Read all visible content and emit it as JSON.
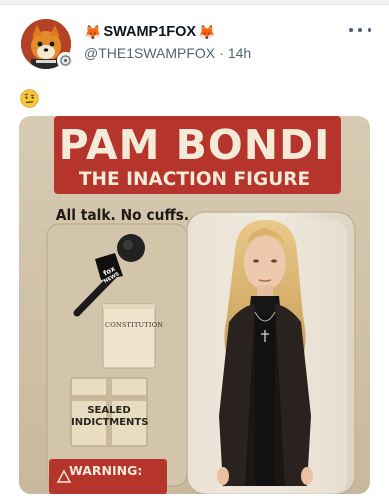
{
  "post": {
    "display_name": "SWAMP1FOX",
    "name_emoji_left": "fox-emoji",
    "name_emoji_right": "fox-emoji",
    "handle": "@THE1SWAMPFOX",
    "separator": "·",
    "time": "14h",
    "body_emoji": "face-with-raised-eyebrow-emoji"
  },
  "image": {
    "title": "PAM BONDI",
    "subtitle": "THE INACTION FIGURE",
    "tagline": "All talk. No cuffs.",
    "book_label": "CONSTITUTION",
    "box_label": "SEALED INDICTMENTS",
    "box_label_line1": "SEALED",
    "box_label_line2": "INDICTMENTS",
    "warning": "WARNING:",
    "mic_flag": "fox NEWS"
  },
  "colors": {
    "package_bg": "#cdbfa6",
    "header_red": "#b5342b",
    "text_cream": "#f4ead8",
    "handle_gray": "#536471"
  }
}
